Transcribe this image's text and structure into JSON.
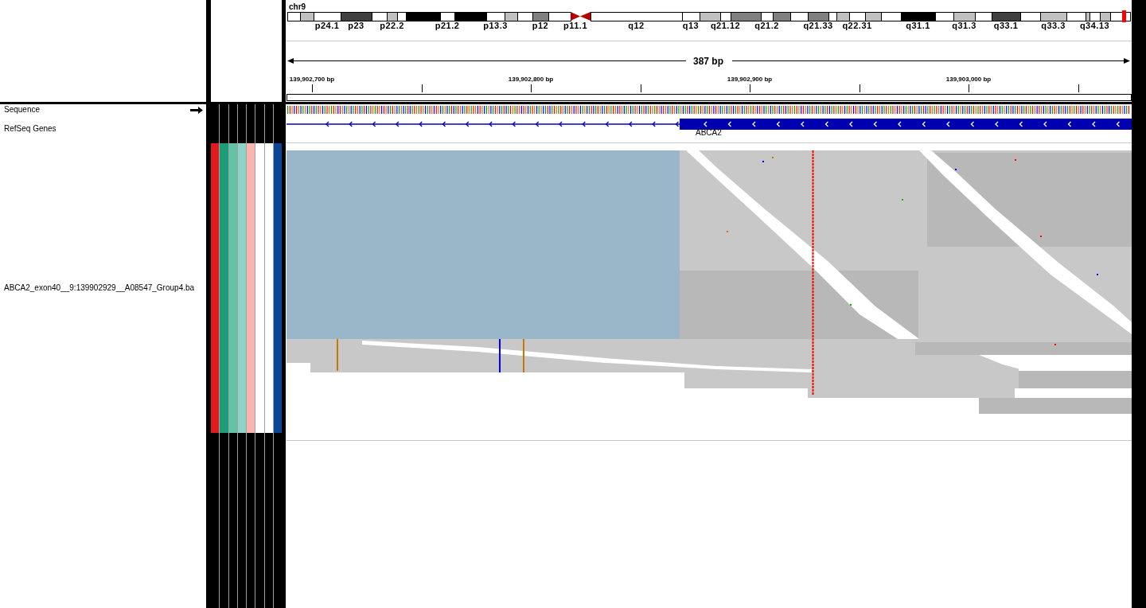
{
  "header": {
    "chromosome": "chr9",
    "span_label": "387 bp",
    "bands": [
      {
        "kind": "band",
        "color": "#ffffff"
      },
      {
        "kind": "band",
        "color": "#c0c0c0"
      },
      {
        "kind": "band",
        "color": "#ffffff",
        "label": "p24.1"
      },
      {
        "kind": "band",
        "color": "#404040",
        "label": "p23"
      },
      {
        "kind": "band",
        "color": "#ffffff"
      },
      {
        "kind": "band",
        "color": "#c0c0c0",
        "label": "p22.2"
      },
      {
        "kind": "band",
        "color": "#ffffff"
      },
      {
        "kind": "band",
        "color": "#000000"
      },
      {
        "kind": "band",
        "color": "#ffffff",
        "label": "p21.2"
      },
      {
        "kind": "band",
        "color": "#000000"
      },
      {
        "kind": "band",
        "color": "#ffffff",
        "label": "p13.3"
      },
      {
        "kind": "band",
        "color": "#c0c0c0"
      },
      {
        "kind": "band",
        "color": "#ffffff"
      },
      {
        "kind": "band",
        "color": "#808080",
        "label": "p12"
      },
      {
        "kind": "band",
        "color": "#ffffff"
      },
      {
        "kind": "centromere",
        "color": "#b40000",
        "label": "p11.1"
      },
      {
        "kind": "centromere",
        "color": "#b40000"
      },
      {
        "kind": "band",
        "color": "#ffffff",
        "label": "q12"
      },
      {
        "kind": "band",
        "color": "#ffffff",
        "label": "q13"
      },
      {
        "kind": "band",
        "color": "#c0c0c0"
      },
      {
        "kind": "band",
        "color": "#ffffff",
        "label": "q21.12"
      },
      {
        "kind": "band",
        "color": "#808080"
      },
      {
        "kind": "band",
        "color": "#ffffff",
        "label": "q21.2"
      },
      {
        "kind": "band",
        "color": "#808080"
      },
      {
        "kind": "band",
        "color": "#ffffff"
      },
      {
        "kind": "band",
        "color": "#808080",
        "label": "q21.33"
      },
      {
        "kind": "band",
        "color": "#ffffff"
      },
      {
        "kind": "band",
        "color": "#c0c0c0"
      },
      {
        "kind": "band",
        "color": "#ffffff",
        "label": "q22.31"
      },
      {
        "kind": "band",
        "color": "#c0c0c0"
      },
      {
        "kind": "band",
        "color": "#ffffff"
      },
      {
        "kind": "band",
        "color": "#000000",
        "label": "q31.1"
      },
      {
        "kind": "band",
        "color": "#ffffff"
      },
      {
        "kind": "band",
        "color": "#c0c0c0",
        "label": "q31.3"
      },
      {
        "kind": "band",
        "color": "#ffffff"
      },
      {
        "kind": "band",
        "color": "#404040",
        "label": "q33.1"
      },
      {
        "kind": "band",
        "color": "#ffffff"
      },
      {
        "kind": "band",
        "color": "#c0c0c0",
        "label": "q33.3"
      },
      {
        "kind": "band",
        "color": "#ffffff"
      },
      {
        "kind": "band",
        "color": "#c0c0c0"
      },
      {
        "kind": "band",
        "color": "#ffffff",
        "label": "q34.13"
      },
      {
        "kind": "band",
        "color": "#c0c0c0"
      },
      {
        "kind": "band",
        "color": "#ffffff"
      }
    ],
    "ruler_labels": [
      "139,902,700 bp",
      "139,902,800 bp",
      "139,902,900 bp",
      "139,903,000 bp"
    ]
  },
  "tracks": [
    {
      "kind": "sequence",
      "name": "Sequence"
    },
    {
      "kind": "gene",
      "name": "RefSeq Genes",
      "gene_label": "ABCA2"
    },
    {
      "kind": "alignment",
      "name": "ABCA2_exon40__9:139902929__A08547_Group4.ba",
      "attributes": [
        {
          "color": "#e31a1c"
        },
        {
          "color": "#1b9e77"
        },
        {
          "color": "#66c2a5"
        },
        {
          "color": "#8dd3c7"
        },
        {
          "color": "#fbb4ae"
        },
        {
          "color": "#ffffff"
        },
        {
          "color": "#ffffff"
        },
        {
          "color": "#0b4595"
        }
      ]
    }
  ]
}
